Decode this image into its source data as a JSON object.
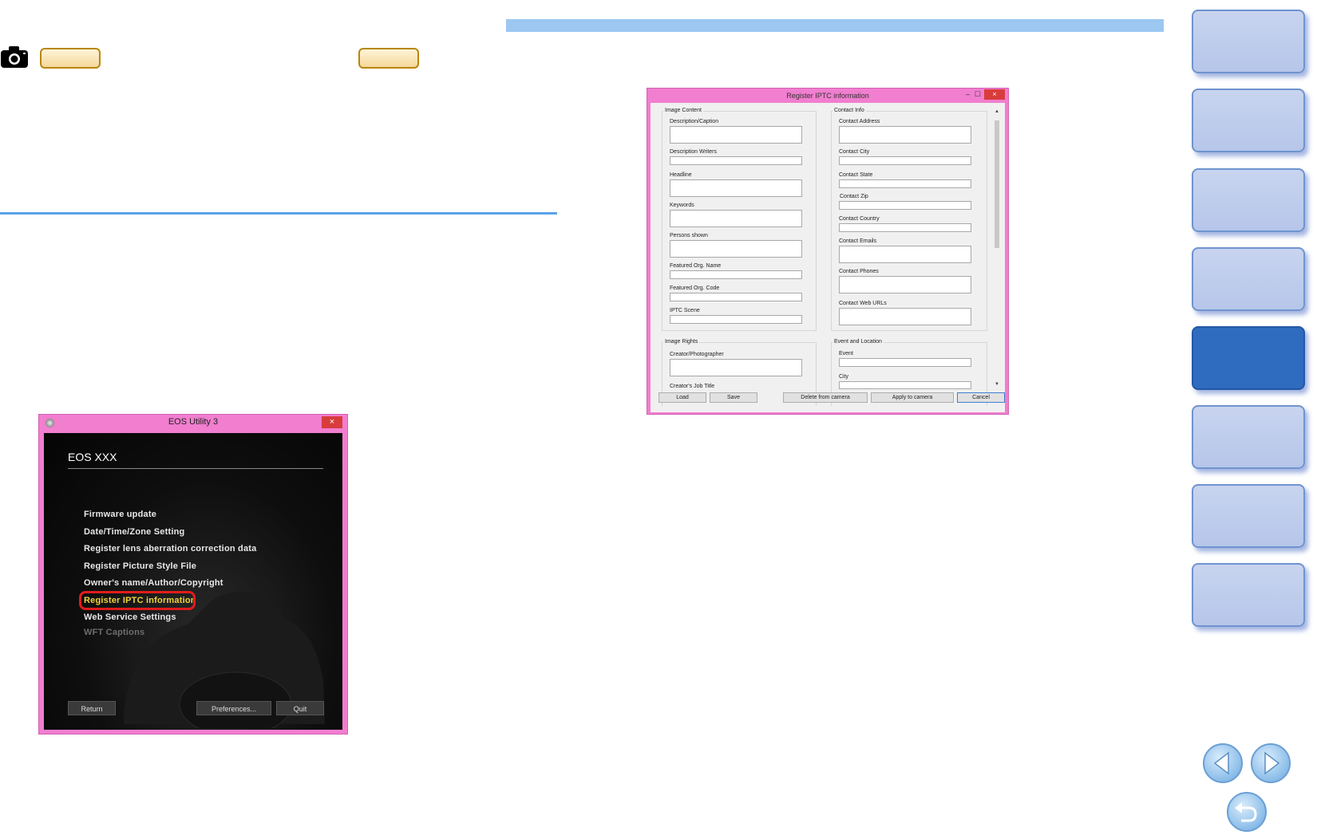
{
  "eos_utility_window": {
    "title": "EOS Utility 3",
    "close_label": "×",
    "model": "EOS XXX",
    "menu_items": [
      {
        "label": "Firmware update",
        "state": "normal"
      },
      {
        "label": "Date/Time/Zone Setting",
        "state": "normal"
      },
      {
        "label": "Register lens aberration correction data",
        "state": "normal"
      },
      {
        "label": "Register Picture Style File",
        "state": "normal"
      },
      {
        "label": "Owner's name/Author/Copyright",
        "state": "normal"
      },
      {
        "label": "Register IPTC information",
        "state": "highlighted"
      },
      {
        "label": "Web Service Settings",
        "state": "normal"
      },
      {
        "label": "WFT Captions",
        "state": "disabled"
      }
    ],
    "buttons": {
      "return": "Return",
      "preferences": "Preferences...",
      "quit": "Quit"
    }
  },
  "iptc_window": {
    "title": "Register IPTC information",
    "controls": {
      "minimize": "–",
      "maximize": "☐",
      "close": "×"
    },
    "groups": {
      "image_content": {
        "label": "Image Content",
        "fields": [
          "Description/Caption",
          "Description Writers",
          "Headline",
          "Keywords",
          "Persons shown",
          "Featured Org. Name",
          "Featured Org. Code",
          "IPTC Scene"
        ]
      },
      "contact_info": {
        "label": "Contact Info",
        "fields": [
          "Contact Address",
          "Contact City",
          "Contact State",
          "Contact Zip",
          "Contact Country",
          "Contact Emails",
          "Contact Phones",
          "Contact Web URLs"
        ]
      },
      "image_rights": {
        "label": "Image Rights",
        "fields": [
          "Creator/Photographer",
          "Creator's Job Title"
        ]
      },
      "event_location": {
        "label": "Event and Location",
        "fields": [
          "Event",
          "City"
        ]
      }
    },
    "scroll": {
      "up": "▲",
      "down": "▼"
    },
    "buttons": {
      "load": "Load",
      "save": "Save",
      "delete": "Delete from camera",
      "apply": "Apply to camera",
      "cancel": "Cancel"
    }
  },
  "colors": {
    "window_frame": "#f17ecf",
    "accent_blue": "#5aa3e8",
    "nav_active": "#2f6bbf",
    "highlight_red": "#e21c1c",
    "selected_text": "#f2d23a"
  },
  "icons": {
    "camera": "camera-icon",
    "nav_prev": "previous-page-icon",
    "nav_next": "next-page-icon",
    "nav_return": "return-icon"
  }
}
